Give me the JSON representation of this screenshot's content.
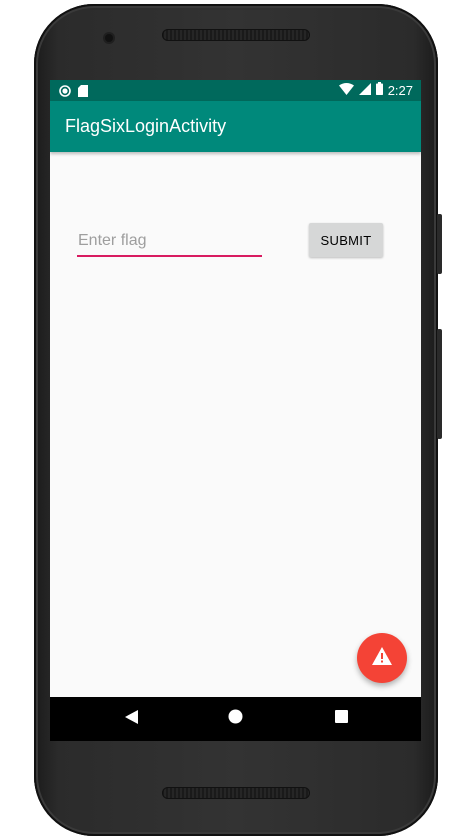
{
  "status_bar": {
    "time": "2:27",
    "icons": [
      "notification-dot-icon",
      "sd-card-icon",
      "wifi-icon",
      "signal-icon",
      "battery-icon"
    ]
  },
  "app_bar": {
    "title": "FlagSixLoginActivity"
  },
  "form": {
    "flag_input": {
      "value": "",
      "placeholder": "Enter flag"
    },
    "submit_label": "SUBMIT"
  },
  "fab": {
    "icon": "warning-icon"
  },
  "nav_bar": {
    "buttons": [
      "back-icon",
      "home-icon",
      "recents-icon"
    ]
  },
  "colors": {
    "status_bar": "#00695c",
    "app_bar": "#00897b",
    "accent": "#d81b60",
    "fab": "#f44336",
    "background": "#fafafa",
    "button": "#d6d7d7"
  }
}
